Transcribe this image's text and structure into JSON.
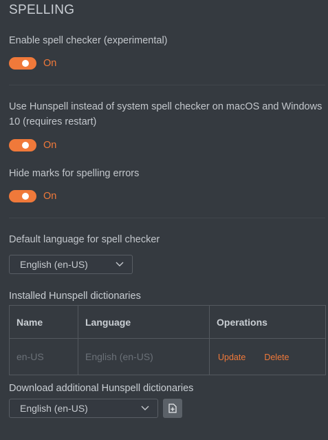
{
  "section": {
    "title": "SPELLING"
  },
  "spell_checker": {
    "label": "Enable spell checker (experimental)",
    "state_text": "On"
  },
  "hunspell": {
    "label_line1": "Use Hunspell instead of system spell checker on macOS and Windows",
    "label_line2": "10 (requires restart)",
    "state_text": "On"
  },
  "hide_marks": {
    "label": "Hide marks for spelling errors",
    "state_text": "On"
  },
  "default_language": {
    "label": "Default language for spell checker",
    "selected": "English (en-US)"
  },
  "installed": {
    "label": "Installed Hunspell dictionaries",
    "columns": [
      "Name",
      "Language",
      "Operations"
    ],
    "rows": [
      {
        "name": "en-US",
        "language": "English (en-US)",
        "update_label": "Update",
        "delete_label": "Delete"
      }
    ]
  },
  "download": {
    "label": "Download additional Hunspell dictionaries",
    "selected": "English (en-US)"
  },
  "icons": {
    "toggle": "toggle-switch",
    "chevron": "chevron-down-icon",
    "upload": "file-upload-icon"
  },
  "colors": {
    "accent": "#f0793a",
    "background": "#353a40"
  }
}
